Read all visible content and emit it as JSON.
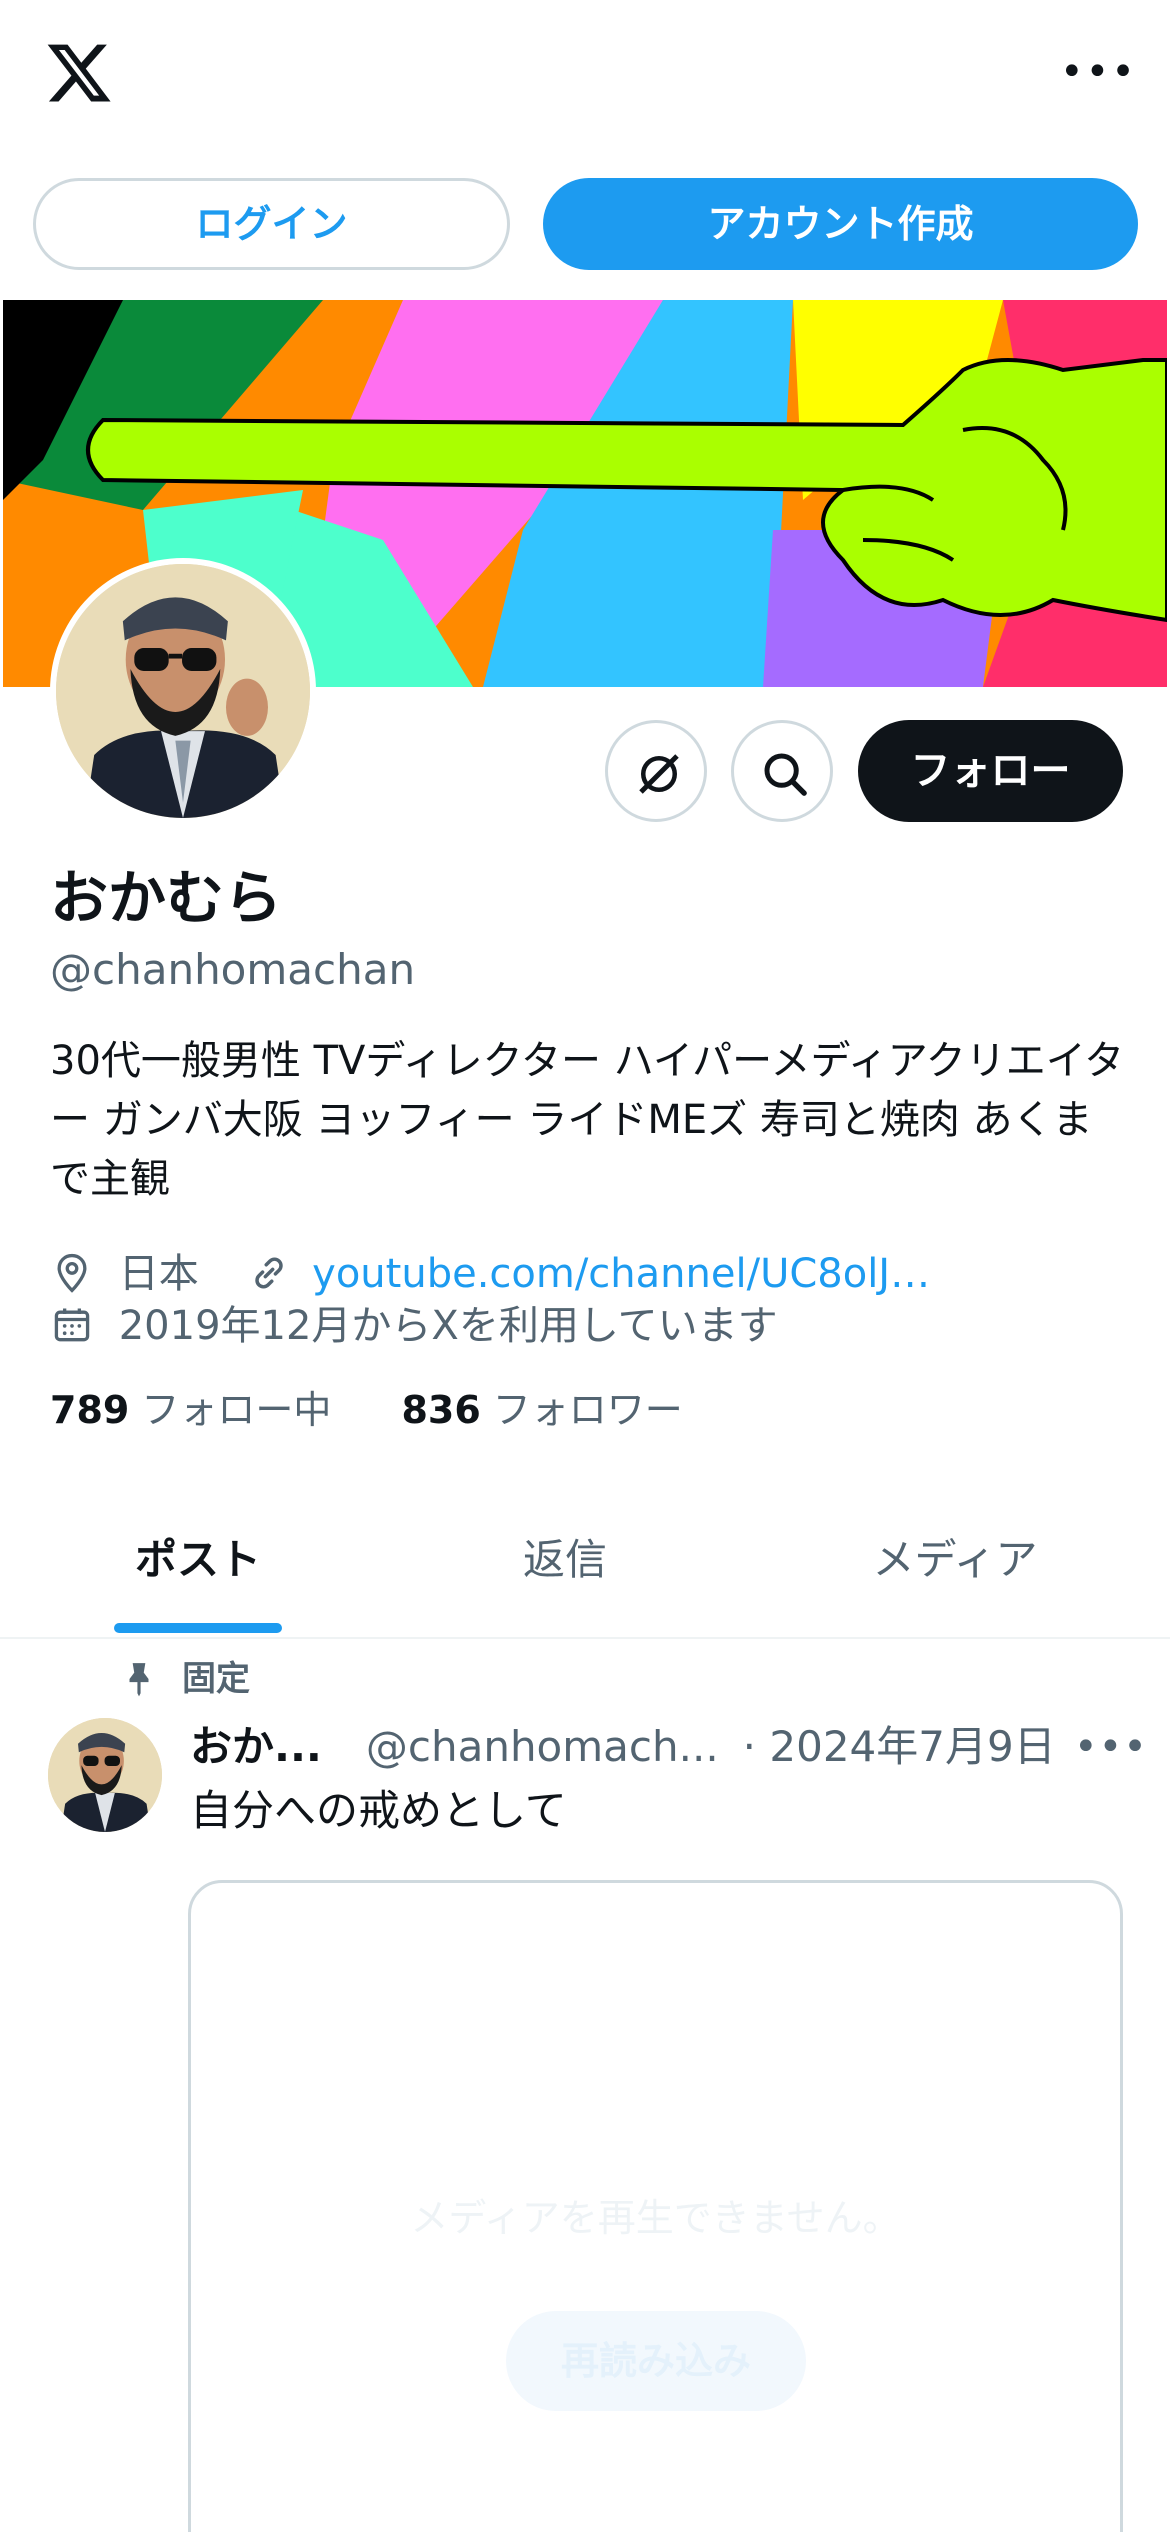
{
  "header": {
    "logo_icon": "x-logo-icon",
    "more_icon": "more-horizontal-icon",
    "more_glyph": "•••"
  },
  "auth": {
    "login_label": "ログイン",
    "signup_label": "アカウント作成"
  },
  "profile": {
    "display_name": "おかむら",
    "handle": "@chanhomachan",
    "bio": "30代一般男性 TVディレクター ハイパーメディアクリエイター ガンバ大阪 ヨッフィー ライドMEズ 寿司と焼肉 あくまで主観",
    "location": "日本",
    "website": "youtube.com/channel/UC8olJ…",
    "joined": "2019年12月からXを利用しています",
    "following_count": "789",
    "following_label": "フォロー中",
    "followers_count": "836",
    "followers_label": "フォロワー",
    "follow_label": "フォロー"
  },
  "actions": {
    "grok_icon": "grok-icon",
    "search_icon": "search-icon"
  },
  "tabs": [
    {
      "label": "ポスト",
      "active": true
    },
    {
      "label": "返信",
      "active": false
    },
    {
      "label": "メディア",
      "active": false
    }
  ],
  "post": {
    "pinned_label": "固定",
    "name": "おか...",
    "handle": "@chanhomach...",
    "date": "· 2024年7月9日",
    "more_glyph": "•••",
    "text": "自分への戒めとして",
    "media_message": "メディアを再生できません。",
    "media_button": "再読み込み"
  },
  "colors": {
    "accent": "#1d9bf0",
    "text_primary": "#0f1419",
    "text_secondary": "#536471",
    "border": "#cfd9de"
  }
}
